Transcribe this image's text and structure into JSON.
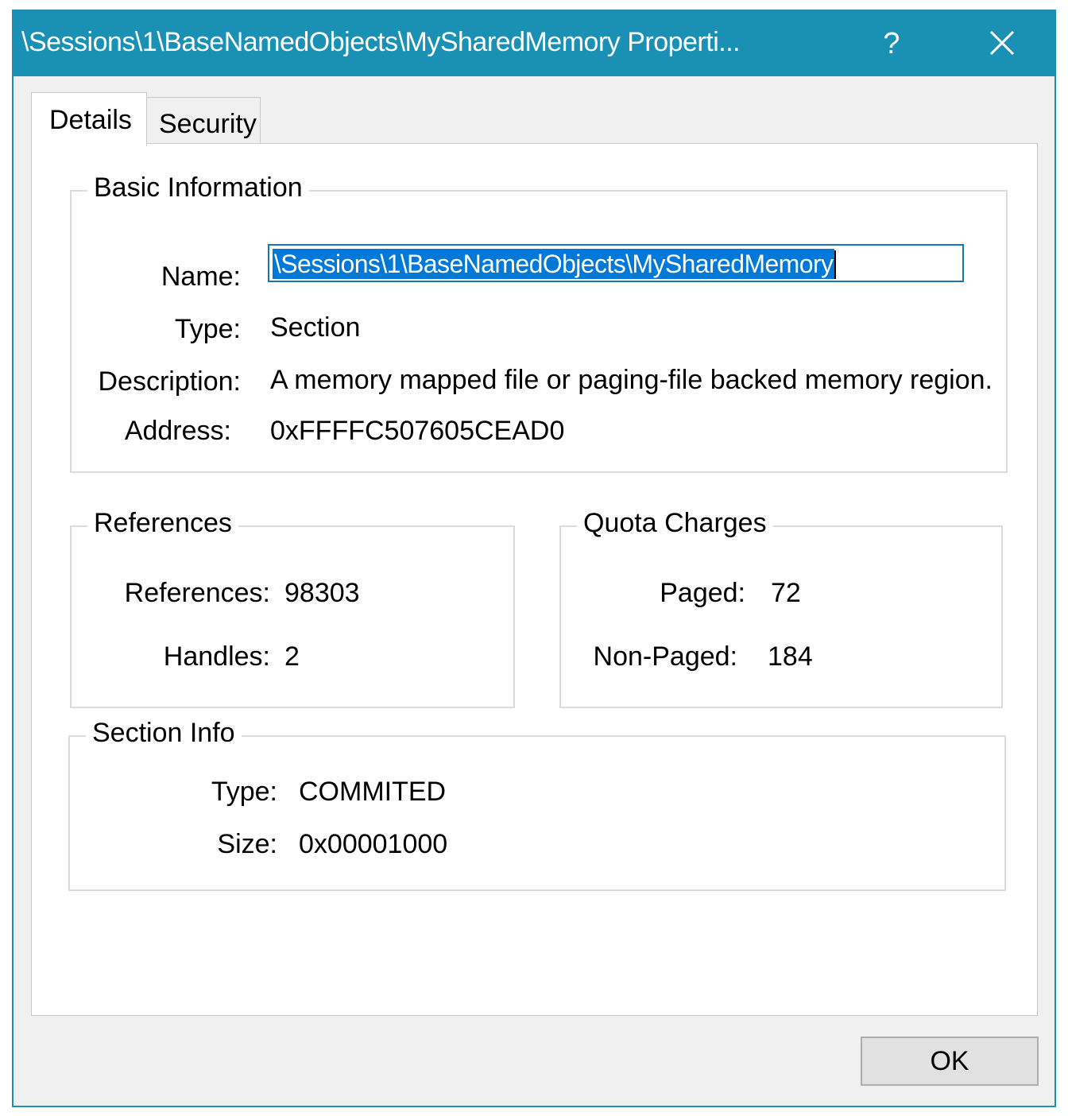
{
  "window": {
    "title": "\\Sessions\\1\\BaseNamedObjects\\MySharedMemory Properti...",
    "help_label": "?",
    "accent_color": "#1a91b4"
  },
  "tabs": [
    {
      "label": "Details",
      "active": true
    },
    {
      "label": "Security",
      "active": false
    }
  ],
  "basic_info": {
    "legend": "Basic Information",
    "name_label": "Name:",
    "name_value": "\\Sessions\\1\\BaseNamedObjects\\MySharedMemory",
    "type_label": "Type:",
    "type_value": "Section",
    "description_label": "Description:",
    "description_value": "A memory mapped file or paging-file backed memory region.",
    "address_label": "Address:",
    "address_value": "0xFFFFC507605CEAD0"
  },
  "references": {
    "legend": "References",
    "references_label": "References:",
    "references_value": "98303",
    "handles_label": "Handles:",
    "handles_value": "2"
  },
  "quota": {
    "legend": "Quota Charges",
    "paged_label": "Paged:",
    "paged_value": "72",
    "nonpaged_label": "Non-Paged:",
    "nonpaged_value": "184"
  },
  "section_info": {
    "legend": "Section Info",
    "type_label": "Type:",
    "type_value": "COMMITED",
    "size_label": "Size:",
    "size_value": "0x00001000"
  },
  "buttons": {
    "ok_label": "OK"
  }
}
